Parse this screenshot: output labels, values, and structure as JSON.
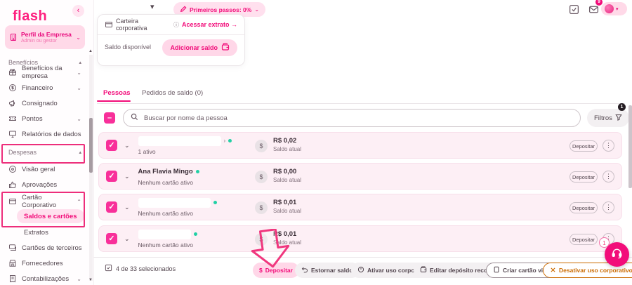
{
  "brand": {
    "logo_text": "flash",
    "accent": "#F20D7A"
  },
  "topbar": {
    "primeiros_passos_label": "Primeiros passos: 0%",
    "mail_badge": "9"
  },
  "sidebar": {
    "profile": {
      "title": "Perfil da Empresa",
      "subtitle": "Admin ou gestor"
    },
    "sections": [
      {
        "label": "Benefícios",
        "items": [
          {
            "label": "Benefícios da empresa",
            "icon": "gift-icon"
          },
          {
            "label": "Financeiro",
            "icon": "coins-icon"
          },
          {
            "label": "Consignado",
            "icon": "megaphone-icon"
          },
          {
            "label": "Pontos",
            "icon": "ticket-icon"
          },
          {
            "label": "Relatórios de dados",
            "icon": "monitor-icon"
          }
        ]
      },
      {
        "label": "Despesas",
        "items": [
          {
            "label": "Visão geral",
            "icon": "target-icon"
          },
          {
            "label": "Aprovações",
            "icon": "thumbs-up-icon"
          },
          {
            "label": "Cartão Corporativo",
            "icon": "card-icon"
          },
          {
            "label": "Saldos e cartões",
            "active": true
          },
          {
            "label": "Extratos"
          },
          {
            "label": "Cartões de terceiros",
            "icon": "cards-icon"
          },
          {
            "label": "Fornecedores",
            "icon": "store-icon"
          },
          {
            "label": "Contabilizações",
            "icon": "receipt-icon"
          }
        ]
      }
    ]
  },
  "wallet_card": {
    "title": "Carteira corporativa",
    "info_icon": "ⓘ",
    "link_label": "Acessar extrato →",
    "balance_label": "Saldo disponível",
    "add_button_label": "Adicionar saldo"
  },
  "tabs": [
    {
      "label": "Pessoas",
      "active": true
    },
    {
      "label": "Pedidos de saldo (0)",
      "active": false
    }
  ],
  "toolbar": {
    "search_placeholder": "Buscar por nome da pessoa",
    "filters_label": "Filtros",
    "filters_badge": "1"
  },
  "people": {
    "rows": [
      {
        "name": "",
        "redacted": true,
        "tail": "›",
        "status": "1 ativo",
        "value": "R$ 0,02",
        "value_label": "Saldo atual",
        "action": "Depositar"
      },
      {
        "name": "Ana Flavia Mingo",
        "redacted": false,
        "status": "Nenhum cartão ativo",
        "value": "R$ 0,00",
        "value_label": "Saldo atual",
        "action": "Depositar"
      },
      {
        "name": "",
        "redacted": true,
        "status": "Nenhum cartão ativo",
        "value": "R$ 0,01",
        "value_label": "Saldo atual",
        "action": "Depositar"
      },
      {
        "name": "",
        "redacted": true,
        "status": "Nenhum cartão ativo",
        "value": "R$ 0,01",
        "value_label": "Saldo atual",
        "action": "Depositar"
      }
    ]
  },
  "footer": {
    "selected_text": "4 de 33 selecionados",
    "actions": [
      {
        "label": "Depositar",
        "style": "primary",
        "icon": "dollar-icon"
      },
      {
        "label": "Estornar saldo",
        "style": "default",
        "icon": "undo-icon"
      },
      {
        "label": "Ativar uso corporativo",
        "style": "default",
        "icon": "power-circle-icon"
      },
      {
        "label": "Editar depósito recorrente",
        "style": "default",
        "icon": "wallet-icon"
      },
      {
        "label": "Criar cartão virtual",
        "style": "outline",
        "icon": "card-icon"
      },
      {
        "label": "Desativar uso corporativo",
        "style": "warning",
        "icon": "x-icon"
      }
    ]
  },
  "support_fab_badge": "1",
  "colors": {
    "primary_pink": "#F20D7A",
    "light_pink_bg": "#FFE0EE",
    "row_pink_bg": "#FDEFF5",
    "annotation": "#ED2E7B",
    "warning_orange": "#CC6B00",
    "success_teal": "#21D0A5"
  }
}
